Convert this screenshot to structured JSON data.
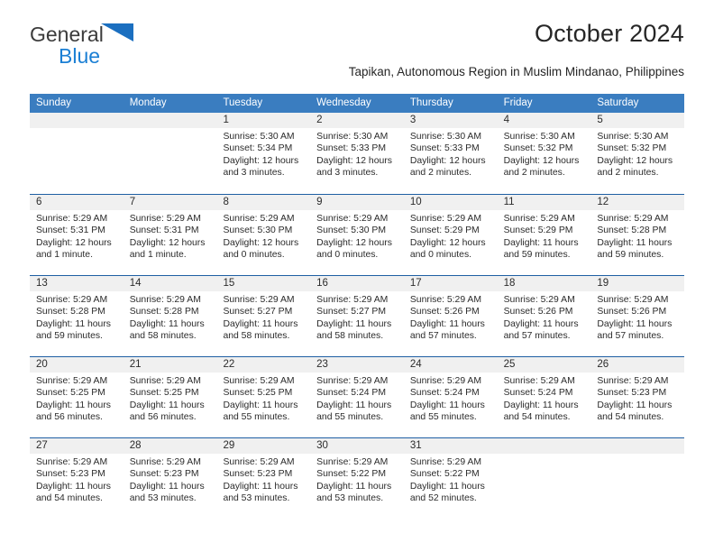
{
  "brand": {
    "name_top": "General",
    "name_bottom": "Blue",
    "triangle_icon": "blue-triangle-icon",
    "color_dark": "#3b3b3b",
    "color_blue": "#1b7fd4"
  },
  "header": {
    "month_year": "October 2024",
    "location": "Tapikan, Autonomous Region in Muslim Mindanao, Philippines"
  },
  "theme": {
    "header_row_bg": "#3a7dc0",
    "week_divider": "#1f5fa3",
    "daynum_band_bg": "#f0f0f0",
    "text": "#2b2b2b"
  },
  "calendar": {
    "weekday_headers": [
      "Sunday",
      "Monday",
      "Tuesday",
      "Wednesday",
      "Thursday",
      "Friday",
      "Saturday"
    ],
    "labels": {
      "sunrise": "Sunrise:",
      "sunset": "Sunset:",
      "daylight": "Daylight:"
    },
    "weeks": [
      [
        {
          "day": "",
          "empty": true
        },
        {
          "day": "",
          "empty": true
        },
        {
          "day": "1",
          "sunrise": "Sunrise: 5:30 AM",
          "sunset": "Sunset: 5:34 PM",
          "daylight_line1": "Daylight: 12 hours",
          "daylight_line2": "and 3 minutes."
        },
        {
          "day": "2",
          "sunrise": "Sunrise: 5:30 AM",
          "sunset": "Sunset: 5:33 PM",
          "daylight_line1": "Daylight: 12 hours",
          "daylight_line2": "and 3 minutes."
        },
        {
          "day": "3",
          "sunrise": "Sunrise: 5:30 AM",
          "sunset": "Sunset: 5:33 PM",
          "daylight_line1": "Daylight: 12 hours",
          "daylight_line2": "and 2 minutes."
        },
        {
          "day": "4",
          "sunrise": "Sunrise: 5:30 AM",
          "sunset": "Sunset: 5:32 PM",
          "daylight_line1": "Daylight: 12 hours",
          "daylight_line2": "and 2 minutes."
        },
        {
          "day": "5",
          "sunrise": "Sunrise: 5:30 AM",
          "sunset": "Sunset: 5:32 PM",
          "daylight_line1": "Daylight: 12 hours",
          "daylight_line2": "and 2 minutes."
        }
      ],
      [
        {
          "day": "6",
          "sunrise": "Sunrise: 5:29 AM",
          "sunset": "Sunset: 5:31 PM",
          "daylight_line1": "Daylight: 12 hours",
          "daylight_line2": "and 1 minute."
        },
        {
          "day": "7",
          "sunrise": "Sunrise: 5:29 AM",
          "sunset": "Sunset: 5:31 PM",
          "daylight_line1": "Daylight: 12 hours",
          "daylight_line2": "and 1 minute."
        },
        {
          "day": "8",
          "sunrise": "Sunrise: 5:29 AM",
          "sunset": "Sunset: 5:30 PM",
          "daylight_line1": "Daylight: 12 hours",
          "daylight_line2": "and 0 minutes."
        },
        {
          "day": "9",
          "sunrise": "Sunrise: 5:29 AM",
          "sunset": "Sunset: 5:30 PM",
          "daylight_line1": "Daylight: 12 hours",
          "daylight_line2": "and 0 minutes."
        },
        {
          "day": "10",
          "sunrise": "Sunrise: 5:29 AM",
          "sunset": "Sunset: 5:29 PM",
          "daylight_line1": "Daylight: 12 hours",
          "daylight_line2": "and 0 minutes."
        },
        {
          "day": "11",
          "sunrise": "Sunrise: 5:29 AM",
          "sunset": "Sunset: 5:29 PM",
          "daylight_line1": "Daylight: 11 hours",
          "daylight_line2": "and 59 minutes."
        },
        {
          "day": "12",
          "sunrise": "Sunrise: 5:29 AM",
          "sunset": "Sunset: 5:28 PM",
          "daylight_line1": "Daylight: 11 hours",
          "daylight_line2": "and 59 minutes."
        }
      ],
      [
        {
          "day": "13",
          "sunrise": "Sunrise: 5:29 AM",
          "sunset": "Sunset: 5:28 PM",
          "daylight_line1": "Daylight: 11 hours",
          "daylight_line2": "and 59 minutes."
        },
        {
          "day": "14",
          "sunrise": "Sunrise: 5:29 AM",
          "sunset": "Sunset: 5:28 PM",
          "daylight_line1": "Daylight: 11 hours",
          "daylight_line2": "and 58 minutes."
        },
        {
          "day": "15",
          "sunrise": "Sunrise: 5:29 AM",
          "sunset": "Sunset: 5:27 PM",
          "daylight_line1": "Daylight: 11 hours",
          "daylight_line2": "and 58 minutes."
        },
        {
          "day": "16",
          "sunrise": "Sunrise: 5:29 AM",
          "sunset": "Sunset: 5:27 PM",
          "daylight_line1": "Daylight: 11 hours",
          "daylight_line2": "and 58 minutes."
        },
        {
          "day": "17",
          "sunrise": "Sunrise: 5:29 AM",
          "sunset": "Sunset: 5:26 PM",
          "daylight_line1": "Daylight: 11 hours",
          "daylight_line2": "and 57 minutes."
        },
        {
          "day": "18",
          "sunrise": "Sunrise: 5:29 AM",
          "sunset": "Sunset: 5:26 PM",
          "daylight_line1": "Daylight: 11 hours",
          "daylight_line2": "and 57 minutes."
        },
        {
          "day": "19",
          "sunrise": "Sunrise: 5:29 AM",
          "sunset": "Sunset: 5:26 PM",
          "daylight_line1": "Daylight: 11 hours",
          "daylight_line2": "and 57 minutes."
        }
      ],
      [
        {
          "day": "20",
          "sunrise": "Sunrise: 5:29 AM",
          "sunset": "Sunset: 5:25 PM",
          "daylight_line1": "Daylight: 11 hours",
          "daylight_line2": "and 56 minutes."
        },
        {
          "day": "21",
          "sunrise": "Sunrise: 5:29 AM",
          "sunset": "Sunset: 5:25 PM",
          "daylight_line1": "Daylight: 11 hours",
          "daylight_line2": "and 56 minutes."
        },
        {
          "day": "22",
          "sunrise": "Sunrise: 5:29 AM",
          "sunset": "Sunset: 5:25 PM",
          "daylight_line1": "Daylight: 11 hours",
          "daylight_line2": "and 55 minutes."
        },
        {
          "day": "23",
          "sunrise": "Sunrise: 5:29 AM",
          "sunset": "Sunset: 5:24 PM",
          "daylight_line1": "Daylight: 11 hours",
          "daylight_line2": "and 55 minutes."
        },
        {
          "day": "24",
          "sunrise": "Sunrise: 5:29 AM",
          "sunset": "Sunset: 5:24 PM",
          "daylight_line1": "Daylight: 11 hours",
          "daylight_line2": "and 55 minutes."
        },
        {
          "day": "25",
          "sunrise": "Sunrise: 5:29 AM",
          "sunset": "Sunset: 5:24 PM",
          "daylight_line1": "Daylight: 11 hours",
          "daylight_line2": "and 54 minutes."
        },
        {
          "day": "26",
          "sunrise": "Sunrise: 5:29 AM",
          "sunset": "Sunset: 5:23 PM",
          "daylight_line1": "Daylight: 11 hours",
          "daylight_line2": "and 54 minutes."
        }
      ],
      [
        {
          "day": "27",
          "sunrise": "Sunrise: 5:29 AM",
          "sunset": "Sunset: 5:23 PM",
          "daylight_line1": "Daylight: 11 hours",
          "daylight_line2": "and 54 minutes."
        },
        {
          "day": "28",
          "sunrise": "Sunrise: 5:29 AM",
          "sunset": "Sunset: 5:23 PM",
          "daylight_line1": "Daylight: 11 hours",
          "daylight_line2": "and 53 minutes."
        },
        {
          "day": "29",
          "sunrise": "Sunrise: 5:29 AM",
          "sunset": "Sunset: 5:23 PM",
          "daylight_line1": "Daylight: 11 hours",
          "daylight_line2": "and 53 minutes."
        },
        {
          "day": "30",
          "sunrise": "Sunrise: 5:29 AM",
          "sunset": "Sunset: 5:22 PM",
          "daylight_line1": "Daylight: 11 hours",
          "daylight_line2": "and 53 minutes."
        },
        {
          "day": "31",
          "sunrise": "Sunrise: 5:29 AM",
          "sunset": "Sunset: 5:22 PM",
          "daylight_line1": "Daylight: 11 hours",
          "daylight_line2": "and 52 minutes."
        },
        {
          "day": "",
          "empty": true
        },
        {
          "day": "",
          "empty": true
        }
      ]
    ]
  }
}
